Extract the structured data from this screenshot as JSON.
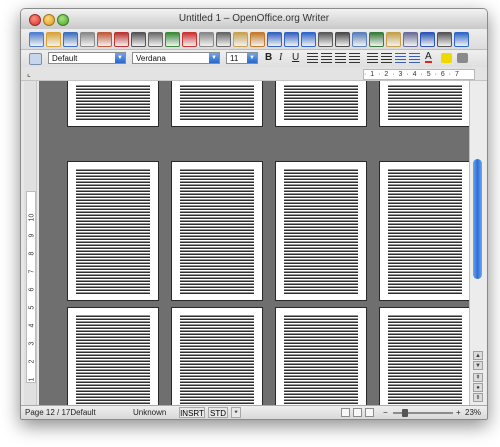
{
  "window": {
    "title": "Untitled 1 – OpenOffice.org Writer"
  },
  "toolbar": {
    "icons": [
      "new-document",
      "open",
      "save",
      "email",
      "edit-file",
      "export-pdf",
      "print",
      "page-preview",
      "spellcheck",
      "autospellcheck",
      "cut",
      "copy",
      "paste",
      "format-paintbrush",
      "undo",
      "redo",
      "hyperlink",
      "table",
      "show-draw-functions",
      "find-replace",
      "navigator",
      "gallery",
      "datasources",
      "nonprinting-characters",
      "zoom",
      "help"
    ]
  },
  "formatting": {
    "paragraph_style": "Default",
    "font_name": "Verdana",
    "font_size": "11",
    "bold_label": "B",
    "italic_label": "I",
    "underline_label": "U"
  },
  "ruler": {
    "text": "· 1 · 2 · 3 · 4 · 5 · 6 · 7"
  },
  "vertical_ruler": {
    "numbers": [
      "1",
      "2",
      "3",
      "4",
      "5",
      "6",
      "7",
      "8",
      "9",
      "10"
    ]
  },
  "status": {
    "page": "Page 12 / 17Default",
    "language": "Unknown",
    "insert_mode": "INSRT",
    "selection_mode": "STD",
    "zoom": "23%"
  }
}
